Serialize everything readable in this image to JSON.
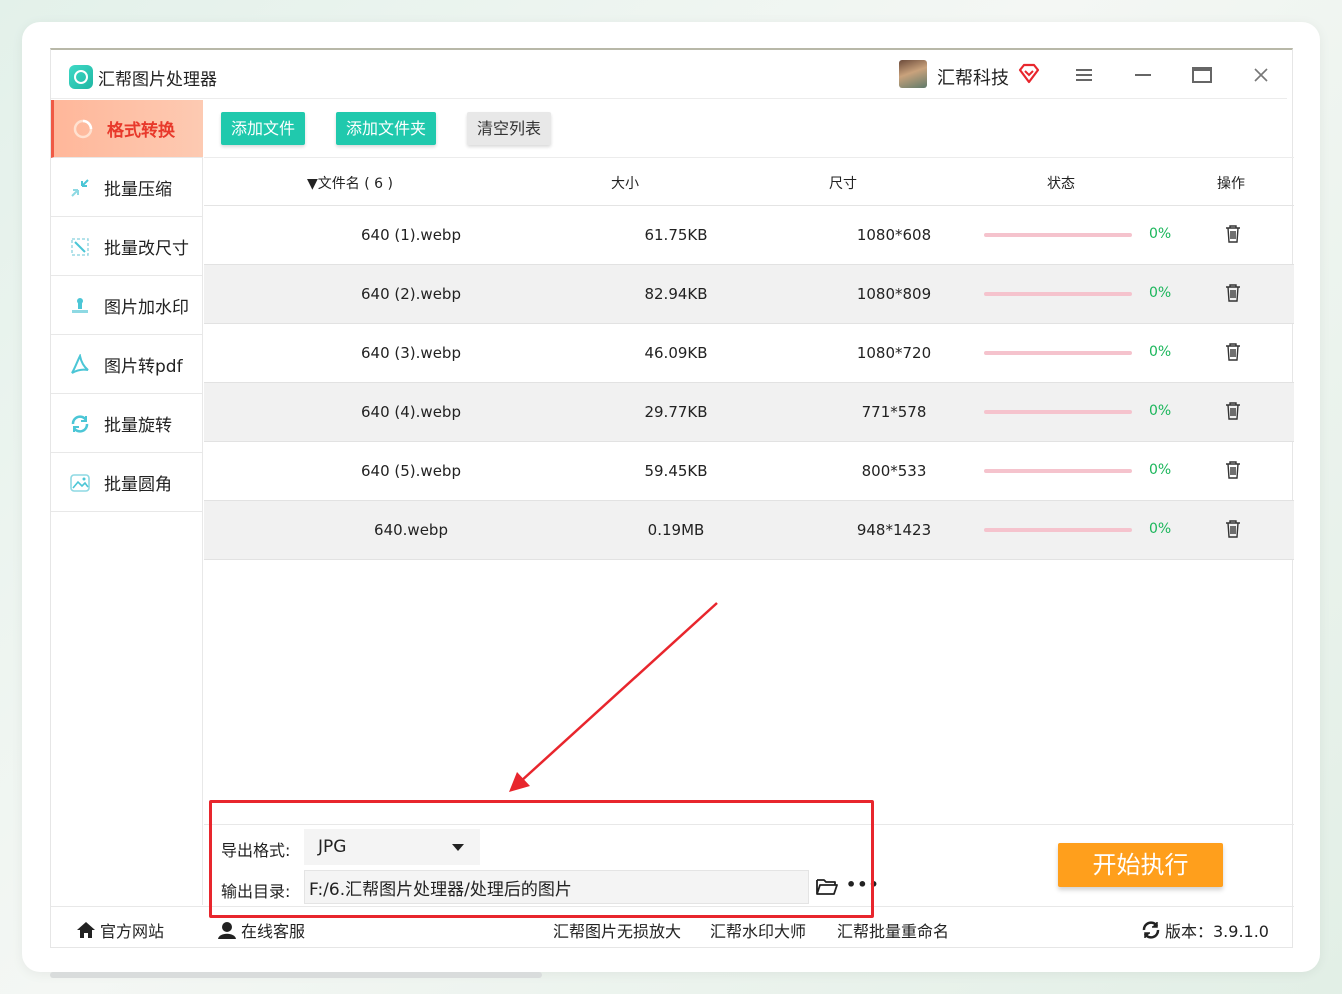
{
  "app": {
    "title": "汇帮图片处理器",
    "user_name": "汇帮科技",
    "version_label": "版本：3.9.1.0"
  },
  "sidebar": {
    "items": [
      {
        "label": "格式转换",
        "icon": "format-convert-icon",
        "active": true
      },
      {
        "label": "批量压缩",
        "icon": "compress-icon"
      },
      {
        "label": "批量改尺寸",
        "icon": "resize-icon"
      },
      {
        "label": "图片加水印",
        "icon": "watermark-icon"
      },
      {
        "label": "图片转pdf",
        "icon": "pdf-icon"
      },
      {
        "label": "批量旋转",
        "icon": "rotate-icon"
      },
      {
        "label": "批量圆角",
        "icon": "round-corner-icon"
      }
    ]
  },
  "toolbar": {
    "add_file": "添加文件",
    "add_folder": "添加文件夹",
    "clear_list": "清空列表"
  },
  "table": {
    "headers": {
      "name": "▼文件名 ( 6 )",
      "size": "大小",
      "dims": "尺寸",
      "status": "状态",
      "action": "操作"
    },
    "rows": [
      {
        "name": "640 (1).webp",
        "size": "61.75KB",
        "dims": "1080*608",
        "pct": "0%",
        "progress": 0
      },
      {
        "name": "640 (2).webp",
        "size": "82.94KB",
        "dims": "1080*809",
        "pct": "0%",
        "progress": 0
      },
      {
        "name": "640 (3).webp",
        "size": "46.09KB",
        "dims": "1080*720",
        "pct": "0%",
        "progress": 0
      },
      {
        "name": "640 (4).webp",
        "size": "29.77KB",
        "dims": "771*578",
        "pct": "0%",
        "progress": 0
      },
      {
        "name": "640 (5).webp",
        "size": "59.45KB",
        "dims": "800*533",
        "pct": "0%",
        "progress": 0
      },
      {
        "name": "640.webp",
        "size": "0.19MB",
        "dims": "948*1423",
        "pct": "0%",
        "progress": 0
      }
    ]
  },
  "settings": {
    "format_label": "导出格式:",
    "format_value": "JPG",
    "output_label": "输出目录:",
    "output_path": "F:/6.汇帮图片处理器/处理后的图片",
    "start_button": "开始执行"
  },
  "footer": {
    "website": "官方网站",
    "support": "在线客服",
    "link1": "汇帮图片无损放大",
    "link2": "汇帮水印大师",
    "link3": "汇帮批量重命名"
  },
  "colors": {
    "accent_green": "#20c9ad",
    "active_red": "#e8392b",
    "start_orange": "#ff9f1c",
    "progress_pink": "#f5c3cd",
    "percent_green": "#1bb65b",
    "annotation_red": "#e8262d"
  }
}
